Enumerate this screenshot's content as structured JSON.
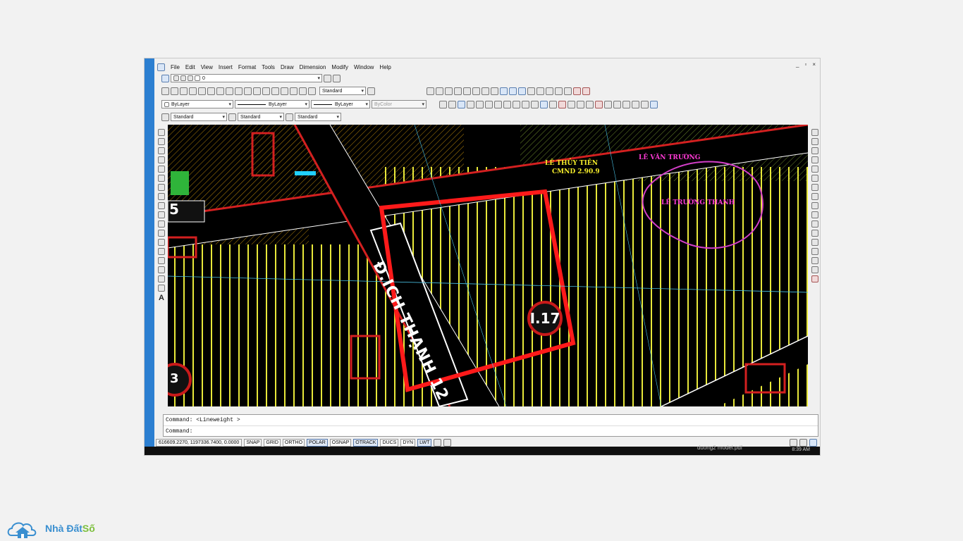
{
  "menu": [
    "File",
    "Edit",
    "View",
    "Insert",
    "Format",
    "Tools",
    "Draw",
    "Dimension",
    "Modify",
    "Window",
    "Help"
  ],
  "window_controls": [
    "_",
    "▫",
    "×"
  ],
  "toolbars": {
    "layer_value": "0",
    "text_style": "Standard",
    "color": "ByLayer",
    "linetype": "ByLayer",
    "lineweight": "ByLayer",
    "plotstyle": "ByColor",
    "style1": "Standard",
    "style2": "Standard",
    "style3": "Standard"
  },
  "drawing": {
    "road_label": "Đ.ICH THẠNH 12",
    "parcel_tag": "I.17",
    "corner_left_top": "5",
    "corner_left_bottom": "3",
    "owner_left": "LÊ THỦY TIÊN",
    "owner_left_sub": "CMND 2.90.9",
    "owner_right": "LÊ VĂN TRƯỜNG",
    "owner_right_sub": "LÊ TRƯỜNG THANH"
  },
  "command": {
    "line1": "Command:  <Lineweight >",
    "line2": "Command:"
  },
  "status": {
    "coordinates": "616609.2270, 1197336.7400, 0.0000",
    "buttons": [
      "SNAP",
      "GRID",
      "ORTHO",
      "POLAR",
      "OSNAP",
      "OTRACK",
      "DUCS",
      "DYN",
      "LWT"
    ],
    "active": [
      "POLAR",
      "OTRACK",
      "LWT"
    ]
  },
  "taskbar": {
    "time": "8:39 AM",
    "file": "duong2 model.pdf"
  },
  "watermark": {
    "brand_blue": "Nhà Đất",
    "brand_green": "Số"
  }
}
